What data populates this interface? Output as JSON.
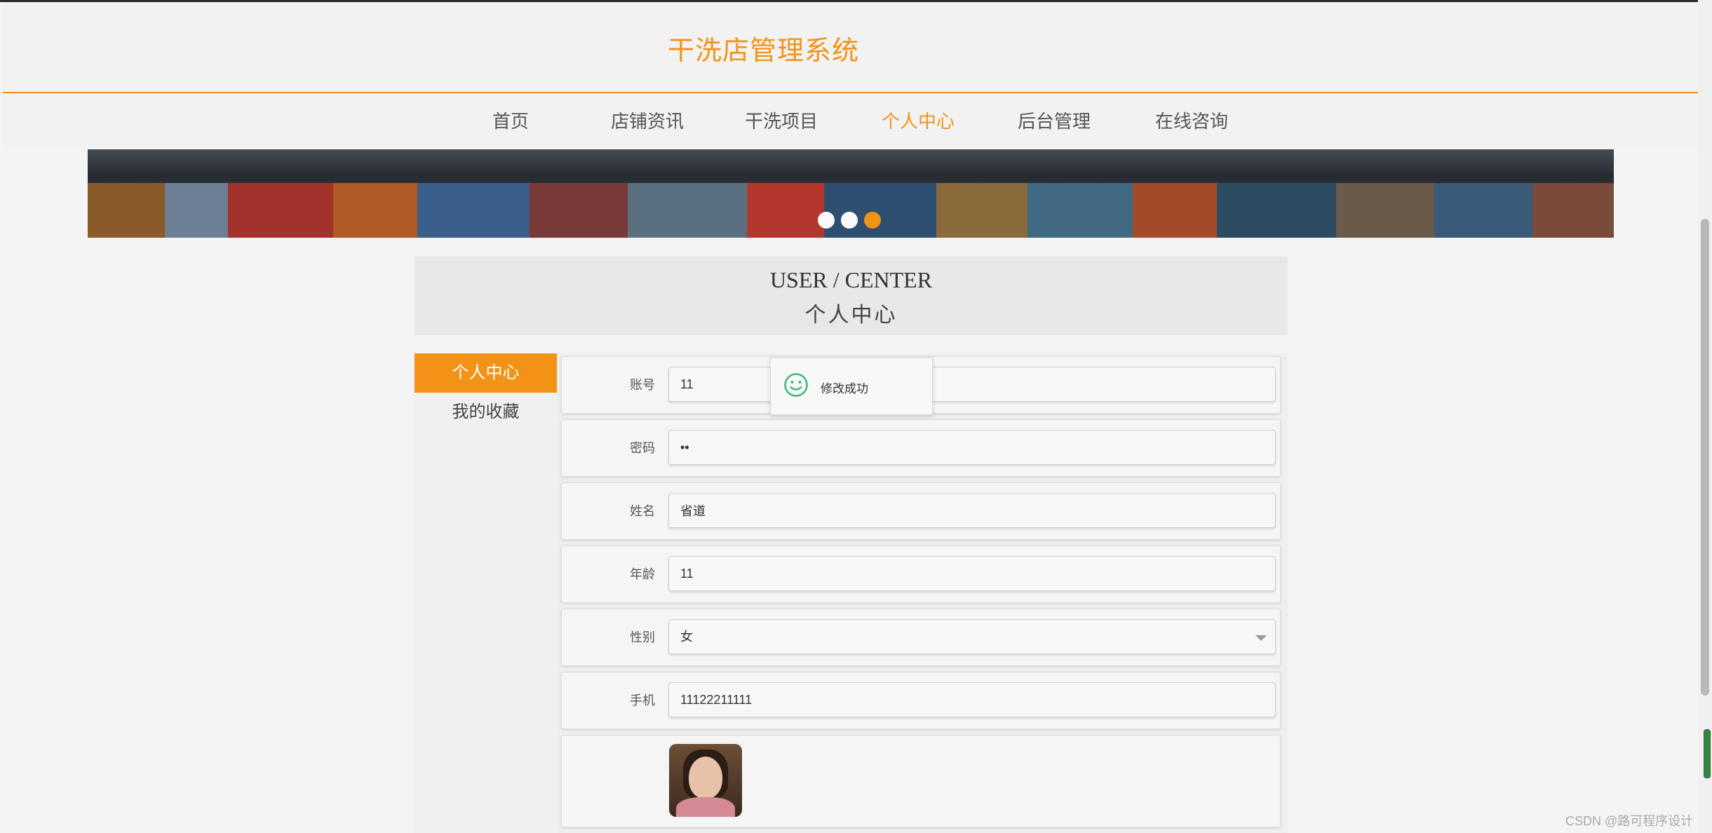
{
  "header": {
    "site_title": "干洗店管理系统"
  },
  "nav": {
    "items": [
      {
        "label": "首页"
      },
      {
        "label": "店铺资讯"
      },
      {
        "label": "干洗项目"
      },
      {
        "label": "个人中心"
      },
      {
        "label": "后台管理"
      },
      {
        "label": "在线咨询"
      }
    ],
    "active": "个人中心"
  },
  "banner": {
    "slide_count": 3,
    "active_slide": 3
  },
  "user_center": {
    "title_en": "USER / CENTER",
    "title_cn": "个人中心"
  },
  "sidebar": {
    "items": [
      {
        "label": "个人中心"
      },
      {
        "label": "我的收藏"
      }
    ],
    "active": "个人中心"
  },
  "form": {
    "account": {
      "label": "账号",
      "value": "11"
    },
    "password": {
      "label": "密码",
      "value": "••"
    },
    "name": {
      "label": "姓名",
      "value": "省道"
    },
    "age": {
      "label": "年龄",
      "value": "11"
    },
    "gender": {
      "label": "性别",
      "value": "女"
    },
    "phone": {
      "label": "手机",
      "value": "11122211111"
    }
  },
  "toast": {
    "text": "修改成功",
    "icon": "smile-icon"
  },
  "colors": {
    "accent": "#f29318",
    "toast_icon": "#3dbb78"
  },
  "watermark": "CSDN @路可程序设计"
}
